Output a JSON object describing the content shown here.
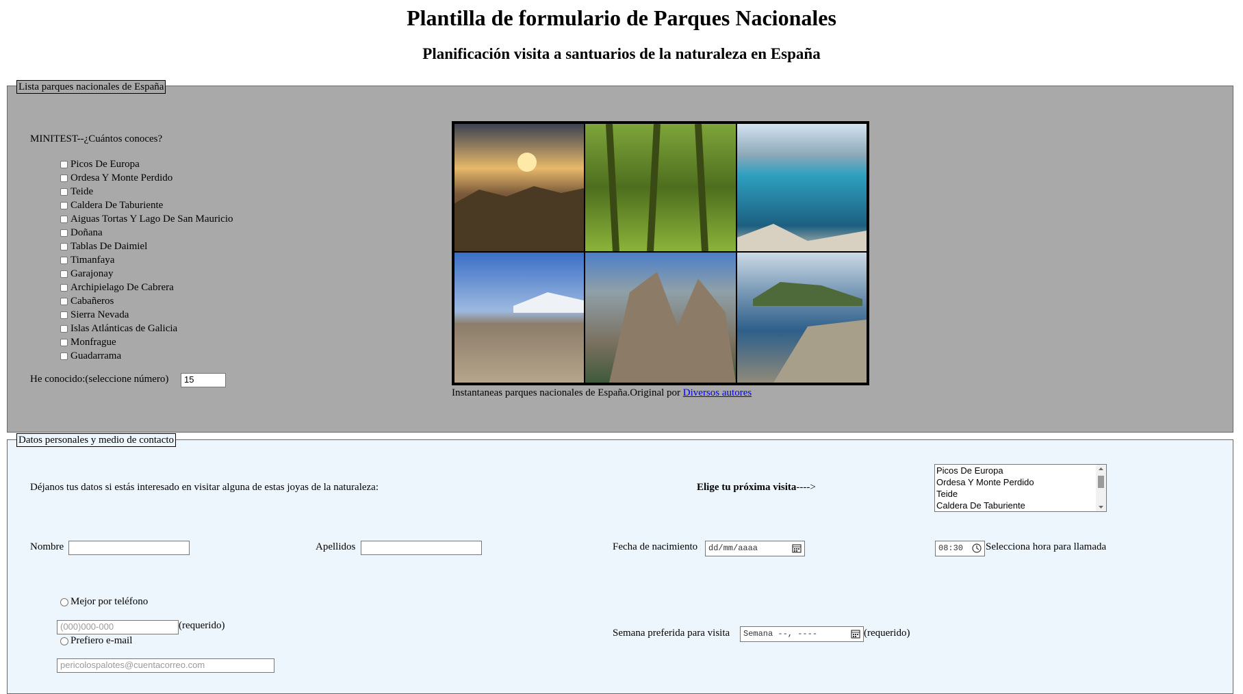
{
  "header": {
    "title": "Plantilla de formulario de Parques Nacionales",
    "subtitle": "Planificación visita a santuarios de la naturaleza en España"
  },
  "section_parks": {
    "legend": "Lista parques nacionales de España",
    "quiz_label": "MINITEST--¿Cuántos conoces?",
    "parks": [
      "Picos De Europa",
      "Ordesa Y Monte Perdido",
      "Teide",
      "Caldera De Taburiente",
      "Aiguas Tortas Y Lago De San Mauricio",
      "Doñana",
      "Tablas De Daimiel",
      "Timanfaya",
      "Garajonay",
      "Archipielago De Cabrera",
      "Cabañeros",
      "Sierra Nevada",
      "Islas Atlánticas de Galicia",
      "Monfrague",
      "Guadarrama"
    ],
    "known_label": "He conocido:(seleccione número)",
    "known_value": "15",
    "caption_text": "Instantaneas parques nacionales de España.Original por ",
    "caption_link": "Diversos autores"
  },
  "section_contact": {
    "legend": "Datos personales y medio de contacto",
    "intro": "Déjanos tus datos si estás interesado en visitar alguna de estas joyas de la naturaleza:",
    "choose_label": "Elige tu próxima visita",
    "choose_arrow": "---->",
    "visit_options": [
      "Picos De Europa",
      "Ordesa Y Monte Perdido",
      "Teide",
      "Caldera De Taburiente"
    ],
    "name_label": "Nombre",
    "surname_label": "Apellidos",
    "birth_label": "Fecha de nacimiento",
    "birth_placeholder": "dd/mm/aaaa",
    "time_value": "08:30",
    "time_label": "Selecciona hora para llamada",
    "phone_radio_label": "Mejor por teléfono",
    "phone_placeholder": "(000)000-000",
    "required_label": "(requerido)",
    "email_radio_label": "Prefiero e-mail",
    "email_placeholder": "pericolospalotes@cuentacorreo.com",
    "week_label": "Semana preferida para visita",
    "week_placeholder": "Semana --, ----",
    "week_required": "(requerido)"
  }
}
